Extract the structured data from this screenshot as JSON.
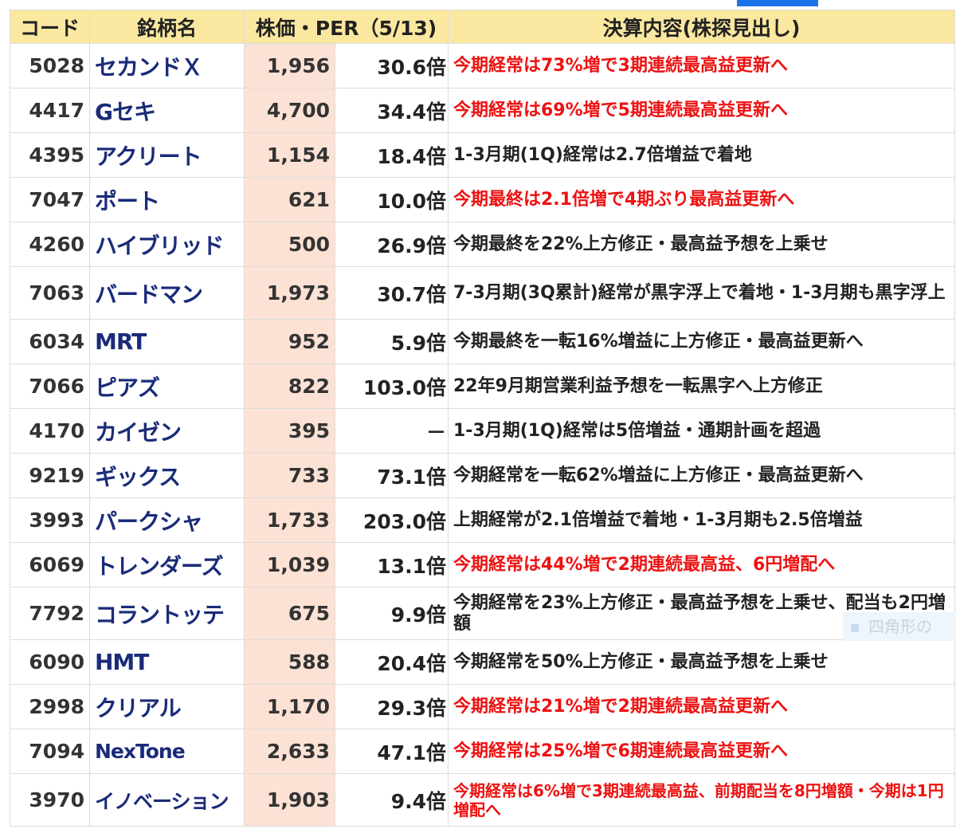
{
  "headers": {
    "code": "コード",
    "name": "銘柄名",
    "price_per": "株価・PER（5/13)",
    "content": "決算内容(株探見出し)"
  },
  "rows": [
    {
      "code": "5028",
      "name": "セカンドＸ",
      "price": "1,956",
      "per": "30.6倍",
      "desc": "今期経常は73%増で3期連続最高益更新へ",
      "red": true
    },
    {
      "code": "4417",
      "name": "Gセキ",
      "price": "4,700",
      "per": "34.4倍",
      "desc": "今期経常は69%増で5期連続最高益更新へ",
      "red": true
    },
    {
      "code": "4395",
      "name": "アクリート",
      "price": "1,154",
      "per": "18.4倍",
      "desc": "1-3月期(1Q)経常は2.7倍増益で着地",
      "red": false
    },
    {
      "code": "7047",
      "name": "ポート",
      "price": "621",
      "per": "10.0倍",
      "desc": "今期最終は2.1倍増で4期ぶり最高益更新へ",
      "red": true
    },
    {
      "code": "4260",
      "name": "ハイブリッド",
      "price": "500",
      "per": "26.9倍",
      "desc": "今期最終を22%上方修正・最高益予想を上乗せ",
      "red": false
    },
    {
      "code": "7063",
      "name": "バードマン",
      "price": "1,973",
      "per": "30.7倍",
      "desc": "7-3月期(3Q累計)経常が黒字浮上で着地・1-3月期も黒字浮上",
      "red": false,
      "tall": true
    },
    {
      "code": "6034",
      "name": "MRT",
      "price": "952",
      "per": "5.9倍",
      "desc": "今期最終を一転16%増益に上方修正・最高益更新へ",
      "red": false
    },
    {
      "code": "7066",
      "name": "ピアズ",
      "price": "822",
      "per": "103.0倍",
      "desc": "22年9月期営業利益予想を一転黒字へ上方修正",
      "red": false
    },
    {
      "code": "4170",
      "name": "カイゼン",
      "price": "395",
      "per": "－",
      "desc": "1-3月期(1Q)経常は5倍増益・通期計画を超過",
      "red": false
    },
    {
      "code": "9219",
      "name": "ギックス",
      "price": "733",
      "per": "73.1倍",
      "desc": "今期経常を一転62%増益に上方修正・最高益更新へ",
      "red": false
    },
    {
      "code": "3993",
      "name": "パークシャ",
      "price": "1,733",
      "per": "203.0倍",
      "desc": "上期経常が2.1倍増益で着地・1-3月期も2.5倍増益",
      "red": false
    },
    {
      "code": "6069",
      "name": "トレンダーズ",
      "price": "1,039",
      "per": "13.1倍",
      "desc": "今期経常は44%増で2期連続最高益、6円増配へ",
      "red": true
    },
    {
      "code": "7792",
      "name": "コラントッテ",
      "price": "675",
      "per": "9.9倍",
      "desc": "今期経常を23%上方修正・最高益予想を上乗せ、配当も2円増額",
      "red": false,
      "tall": true
    },
    {
      "code": "6090",
      "name": "HMT",
      "price": "588",
      "per": "20.4倍",
      "desc": "今期経常を50%上方修正・最高益予想を上乗せ",
      "red": false
    },
    {
      "code": "2998",
      "name": "クリアル",
      "price": "1,170",
      "per": "29.3倍",
      "desc": "今期経常は21%増で2期連続最高益更新へ",
      "red": true
    },
    {
      "code": "7094",
      "name": "NexTone",
      "price": "2,633",
      "per": "47.1倍",
      "desc": "今期経常は25%増で6期連続最高益更新へ",
      "red": true
    },
    {
      "code": "3970",
      "name": "イノベーション",
      "price": "1,903",
      "per": "9.4倍",
      "desc": "今期経常は6%増で3期連続最高益、前期配当を8円増額・今期は1円増配へ",
      "red": true,
      "tall": true,
      "small": true
    }
  ],
  "overlay": {
    "label": "四角形の"
  },
  "colors": {
    "header_bg": "#fbe8a0",
    "price_bg": "#fbe2d5",
    "red_text": "#ee1111",
    "name_text": "#1a2b7a"
  }
}
